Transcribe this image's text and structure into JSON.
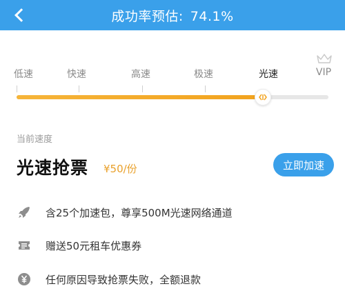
{
  "header": {
    "title_prefix": "成功率预估:",
    "rate": "74.1%",
    "back_icon": "chevron-left-icon",
    "bg_color": "#3aa0ea"
  },
  "speeds": {
    "options": [
      "低速",
      "快速",
      "高速",
      "极速",
      "光速",
      "VIP"
    ],
    "selected": "光速",
    "vip_icon": "crown-icon",
    "slider_fill_fraction": 0.79,
    "fill_color": "#f2a31e"
  },
  "current": {
    "label": "当前速度",
    "plan_name": "光速抢票",
    "price": "¥50/份",
    "button_label": "立即加速",
    "button_color": "#3aa0ea",
    "price_color": "#e9a02a"
  },
  "features": [
    {
      "icon": "rocket-icon",
      "text": "含25个加速包，尊享500M光速网络通道"
    },
    {
      "icon": "ticket-icon",
      "text": "赠送50元租车优惠券"
    },
    {
      "icon": "yen-icon",
      "text": "任何原因导致抢票失败，全额退款"
    }
  ]
}
